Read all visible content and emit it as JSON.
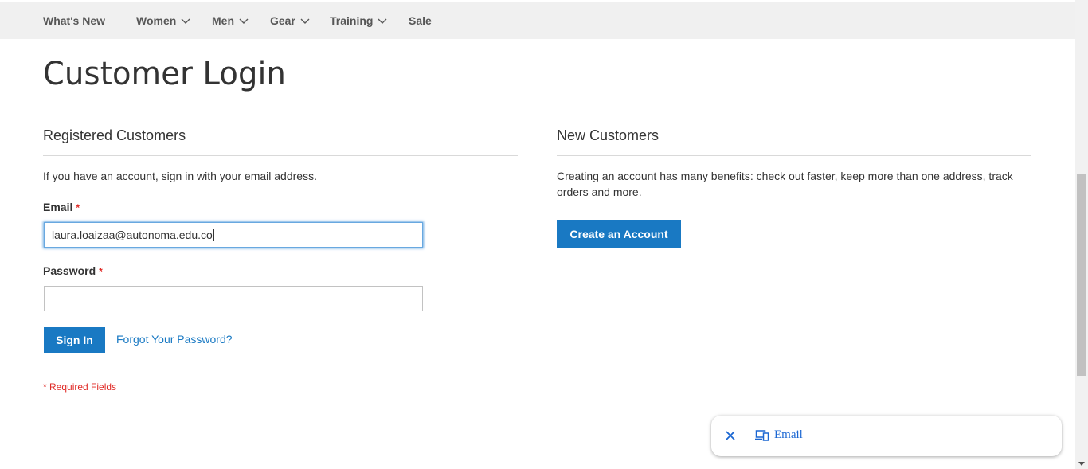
{
  "nav": {
    "items": [
      {
        "label": "What's New",
        "has_dropdown": false
      },
      {
        "label": "Women",
        "has_dropdown": true
      },
      {
        "label": "Men",
        "has_dropdown": true
      },
      {
        "label": "Gear",
        "has_dropdown": true
      },
      {
        "label": "Training",
        "has_dropdown": true
      },
      {
        "label": "Sale",
        "has_dropdown": false
      }
    ]
  },
  "page_title": "Customer Login",
  "registered": {
    "title": "Registered Customers",
    "intro": "If you have an account, sign in with your email address.",
    "email_label": "Email",
    "email_value": "laura.loaizaa@autonoma.edu.co",
    "password_label": "Password",
    "password_value": "",
    "required_star": "*",
    "sign_in_label": "Sign In",
    "forgot_label": "Forgot Your Password?",
    "required_note": "* Required Fields"
  },
  "new_customers": {
    "title": "New Customers",
    "text": "Creating an account has many benefits: check out faster, keep more than one address, track orders and more.",
    "create_label": "Create an Account"
  },
  "autofill_popup": {
    "label": "Email",
    "close_icon": "close-icon",
    "device_icon": "devices-icon"
  },
  "colors": {
    "accent": "#1979c3",
    "required": "#e02b27",
    "nav_bg": "#f0f0f0"
  }
}
